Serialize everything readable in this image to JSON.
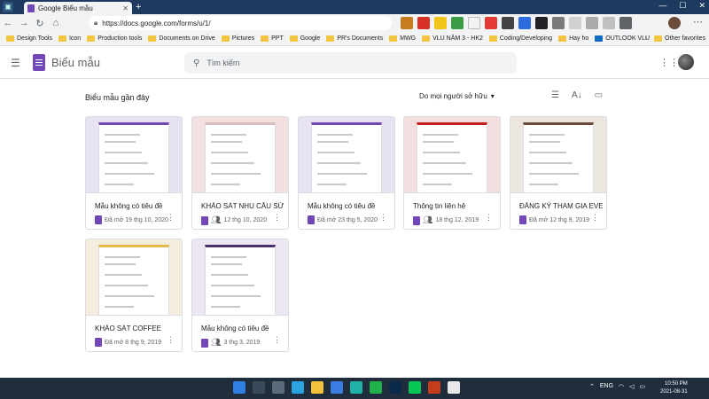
{
  "browser": {
    "tab_title": "Google Biểu mẫu",
    "tab_close": "✕",
    "new_tab": "+",
    "url": "https://docs.google.com/forms/u/1/",
    "window_controls": [
      "—",
      "☐",
      "✕"
    ]
  },
  "bookmarks": [
    "Design Tools",
    "Icon",
    "Production tools",
    "Documents on Drive",
    "Pictures",
    "PPT",
    "Google",
    "PR's Documents",
    "MWG",
    "VLU NĂM 3 - HK2",
    "Coding/Developing",
    "Hay ho",
    "OUTLOOK VLU"
  ],
  "other_favorites": "Other favorites",
  "app": {
    "title": "Biểu mẫu",
    "search_placeholder": "Tìm kiếm",
    "section_title": "Biểu mẫu gần đây",
    "owner_filter": "Do mọi người sở hữu"
  },
  "forms": [
    {
      "title": "Mẫu không có tiêu đề",
      "meta": "Đã mở 19 thg 10, 2020",
      "shared": false,
      "theme": "#e8e3f3",
      "header": "#7248b9"
    },
    {
      "title": "KHẢO SÁT NHU CẦU SỬ DỤNG",
      "meta": "12 thg 10, 2020",
      "shared": true,
      "theme": "#f3e1e1",
      "header": "#d9bebe"
    },
    {
      "title": "Mẫu không có tiêu đề",
      "meta": "Đã mở 23 thg 5, 2020",
      "shared": false,
      "theme": "#e8e3f3",
      "header": "#7248b9"
    },
    {
      "title": "Thông tin liên hệ",
      "meta": "18 thg 12, 2019",
      "shared": true,
      "theme": "#f2dede",
      "header": "#c41e1e"
    },
    {
      "title": "ĐĂNG KÝ THAM GIA EVENT",
      "meta": "Đã mở 12 thg 9, 2019",
      "shared": false,
      "theme": "#ece6e1",
      "header": "#6b4a3a"
    },
    {
      "title": "KHẢO SÁT COFFEE",
      "meta": "Đã mở 8 thg 9, 2019",
      "shared": false,
      "theme": "#f4ecdc",
      "header": "#e8b84a"
    },
    {
      "title": "Mẫu không có tiêu đề",
      "meta": "3 thg 3, 2019",
      "shared": true,
      "theme": "#ece7f2",
      "header": "#4b2f6e"
    }
  ],
  "taskbar": {
    "lang": "ENG",
    "time": "10:50 PM",
    "date": "2021-08-31"
  }
}
